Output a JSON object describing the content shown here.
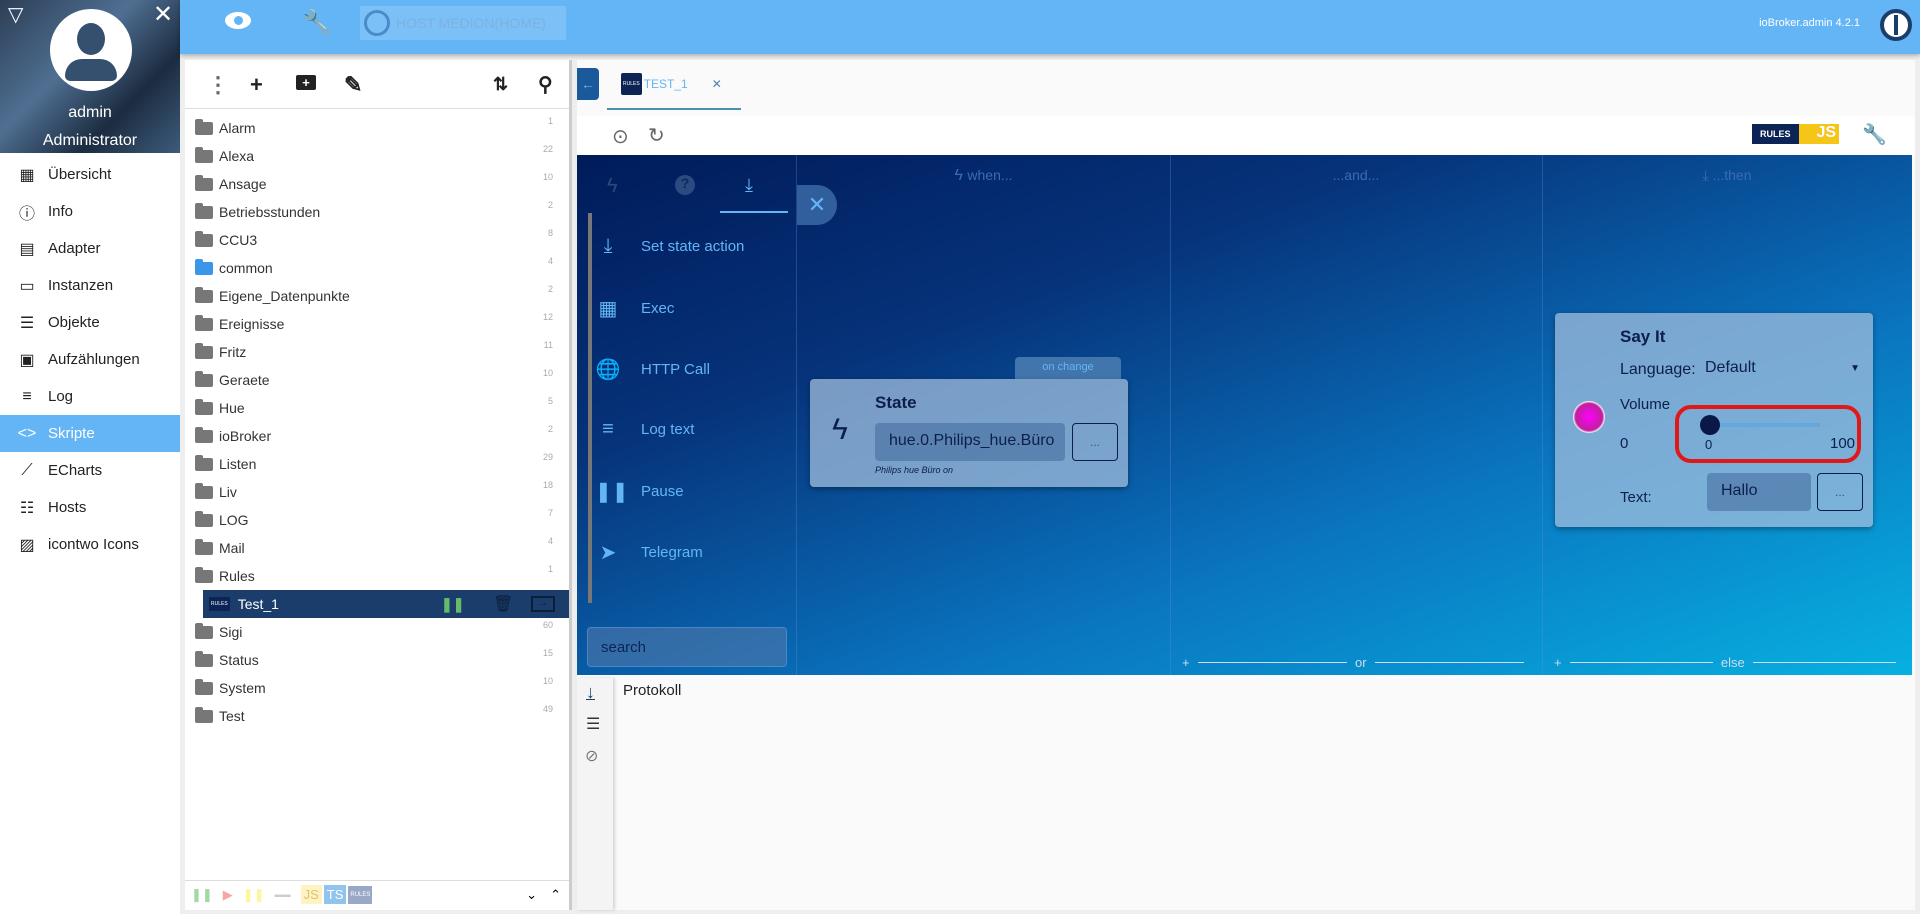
{
  "user": {
    "name": "admin",
    "role": "Administrator"
  },
  "topbar": {
    "host": "HOST MEDION(HOME)",
    "version": "ioBroker.admin 4.2.1"
  },
  "menu": [
    {
      "label": "Übersicht",
      "icon": "grid-icon",
      "glyph": "▦"
    },
    {
      "label": "Info",
      "icon": "info-icon",
      "glyph": "ⓘ"
    },
    {
      "label": "Adapter",
      "icon": "store-icon",
      "glyph": "▤"
    },
    {
      "label": "Instanzen",
      "icon": "instances-icon",
      "glyph": "▭"
    },
    {
      "label": "Objekte",
      "icon": "list-icon",
      "glyph": "☰"
    },
    {
      "label": "Aufzählungen",
      "icon": "enum-icon",
      "glyph": "▣"
    },
    {
      "label": "Log",
      "icon": "log-icon",
      "glyph": "≡"
    },
    {
      "label": "Skripte",
      "icon": "code-icon",
      "glyph": "<>",
      "active": true
    },
    {
      "label": "ECharts",
      "icon": "chart-line-icon",
      "glyph": "⟋"
    },
    {
      "label": "Hosts",
      "icon": "hosts-icon",
      "glyph": "☷"
    },
    {
      "label": "icontwo Icons",
      "icon": "image-icon",
      "glyph": "▨"
    }
  ],
  "scripts": [
    {
      "name": "Alarm",
      "count": "1"
    },
    {
      "name": "Alexa",
      "count": "22"
    },
    {
      "name": "Ansage",
      "count": "10"
    },
    {
      "name": "Betriebsstunden",
      "count": "2"
    },
    {
      "name": "CCU3",
      "count": "8"
    },
    {
      "name": "common",
      "count": "4",
      "blue": true
    },
    {
      "name": "Eigene_Datenpunkte",
      "count": "2"
    },
    {
      "name": "Ereignisse",
      "count": "12"
    },
    {
      "name": "Fritz",
      "count": "11"
    },
    {
      "name": "Geraete",
      "count": "10"
    },
    {
      "name": "Hue",
      "count": "5"
    },
    {
      "name": "ioBroker",
      "count": "2"
    },
    {
      "name": "Listen",
      "count": "29"
    },
    {
      "name": "Liv",
      "count": "18"
    },
    {
      "name": "LOG",
      "count": "7"
    },
    {
      "name": "Mail",
      "count": "4"
    },
    {
      "name": "Rules",
      "count": "1",
      "open": true
    },
    {
      "name": "Test_1",
      "count": "",
      "script": true
    },
    {
      "name": "Sigi",
      "count": "60"
    },
    {
      "name": "Status",
      "count": "15"
    },
    {
      "name": "System",
      "count": "10"
    },
    {
      "name": "Test",
      "count": "49"
    }
  ],
  "footer_badges": {
    "js": "JS",
    "ts": "TS",
    "rules": "RULES"
  },
  "editor": {
    "tab": "TEST_1",
    "tab_badge": "RULES",
    "logo": {
      "rules": "RULES",
      "js": "JS"
    },
    "columns": {
      "when": "when...",
      "and": "...and...",
      "then": "...then",
      "or": "or",
      "else": "else",
      "plus": "+"
    },
    "palette": [
      "Set state action",
      "Exec",
      "HTTP Call",
      "Log text",
      "Pause",
      "Telegram"
    ],
    "search_placeholder": "search",
    "trigger": {
      "badge": "on change",
      "title": "State",
      "value": "hue.0.Philips_hue.Büro",
      "hint": "Philips hue Büro on",
      "dots": "..."
    },
    "action": {
      "title": "Say It",
      "language_label": "Language:",
      "language": "Default",
      "volume_label": "Volume",
      "volume_min": "0",
      "volume_max": "100",
      "volume_value": "0",
      "volume": 0,
      "text_label": "Text:",
      "text": "Hallo",
      "dots": "..."
    }
  },
  "log": {
    "title": "Protokoll"
  }
}
